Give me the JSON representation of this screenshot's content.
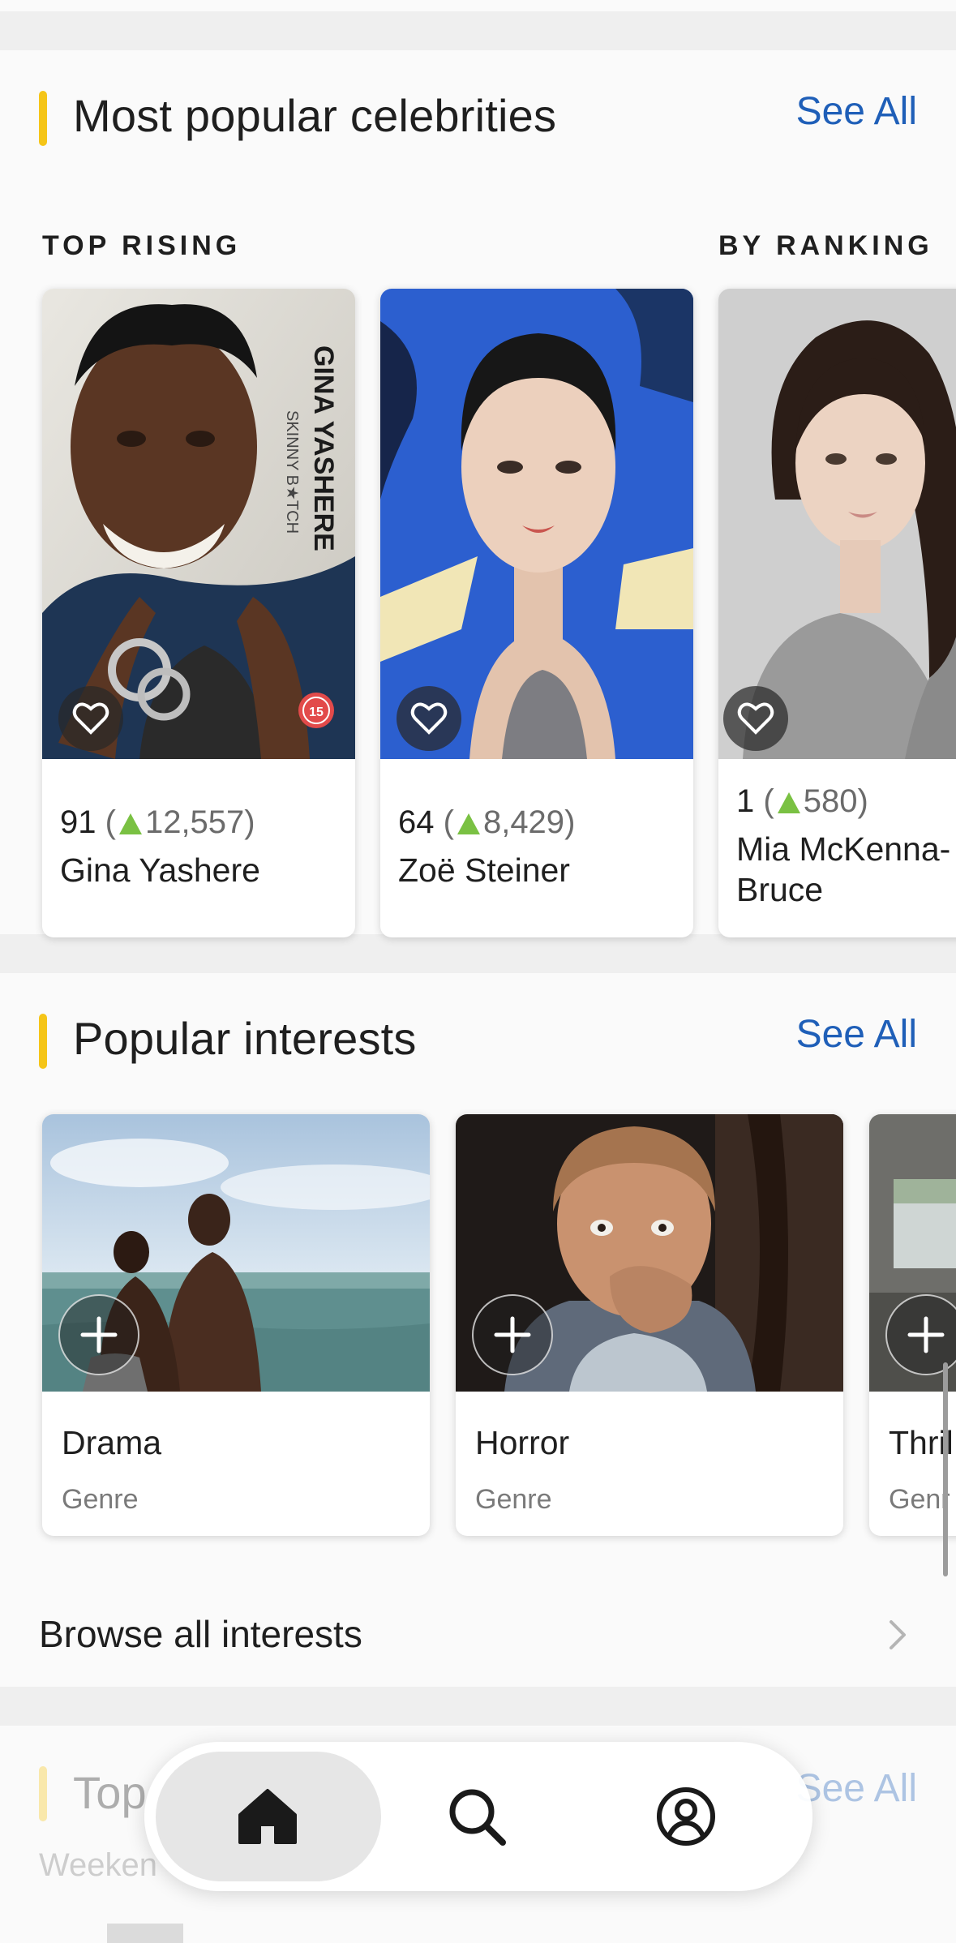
{
  "celebrities": {
    "title": "Most popular celebrities",
    "see_all": "See All",
    "tab_left": "TOP RISING",
    "tab_right": "BY RANKING",
    "items": [
      {
        "rank": "91",
        "delta_open": "(",
        "delta": "12,557",
        "delta_close": ")",
        "name": "Gina Yashere",
        "photo_text_1": "GINA YASHERE",
        "photo_text_2": "SKINNY B★TCH",
        "photo_badge": "15"
      },
      {
        "rank": "64",
        "delta_open": "(",
        "delta": "8,429",
        "delta_close": ")",
        "name": "Zoë Steiner"
      },
      {
        "rank": "1",
        "delta_open": "(",
        "delta": "580",
        "delta_close": ")",
        "name": "Mia McKenna-Bruce"
      }
    ]
  },
  "interests": {
    "title": "Popular interests",
    "see_all": "See All",
    "items": [
      {
        "name": "Drama",
        "type": "Genre"
      },
      {
        "name": "Horror",
        "type": "Genre"
      },
      {
        "name": "Thril",
        "type": "Genr"
      }
    ],
    "browse_all": "Browse all interests"
  },
  "top_box": {
    "title": "Top",
    "subtitle": "Weeken",
    "see_all": "See All"
  },
  "nav": {
    "items": [
      "home-icon",
      "search-icon",
      "profile-icon"
    ],
    "active": "home"
  },
  "colors": {
    "accent": "#f5c518",
    "link": "#1f5fb8",
    "rising": "#7ac143"
  }
}
